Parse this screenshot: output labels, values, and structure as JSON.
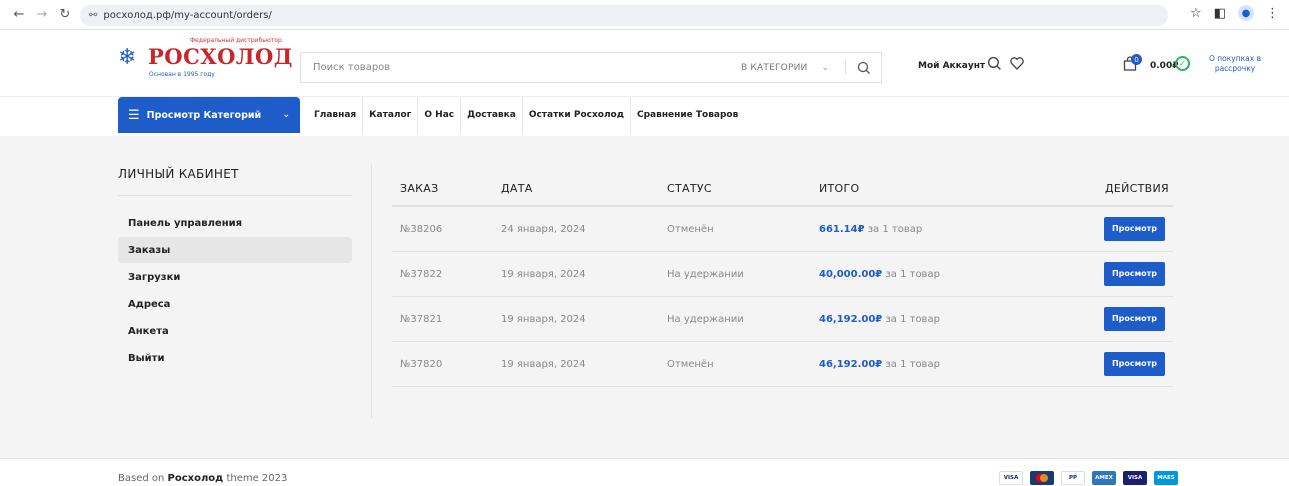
{
  "browser": {
    "url": "росхолод.рф/my-account/orders/"
  },
  "header": {
    "logo_tagline": "Федеральный дистрибьютор",
    "logo_brand": "РОСХОЛОД",
    "logo_since": "Основан в 1995 году",
    "search_placeholder": "Поиск товаров",
    "category_select": "В КАТЕГОРИИ",
    "account_label": "Мой Аккаунт",
    "cart_count": "0",
    "cart_total": "0.00₽",
    "installment_text": "О покупках в рассрочку"
  },
  "nav": {
    "categories_button": "Просмотр Категорий",
    "menu": [
      "Главная",
      "Каталог",
      "О Нас",
      "Доставка",
      "Остатки Росхолод",
      "Сравнение Товаров"
    ]
  },
  "sidebar": {
    "title": "ЛИЧНЫЙ КАБИНЕТ",
    "items": [
      "Панель управления",
      "Заказы",
      "Загрузки",
      "Адреса",
      "Анкета",
      "Выйти"
    ]
  },
  "orders": {
    "columns": [
      "ЗАКАЗ",
      "ДАТА",
      "СТАТУС",
      "ИТОГО",
      "ДЕЙСТВИЯ"
    ],
    "rows": [
      {
        "id": "№38206",
        "date": "24 января, 2024",
        "status": "Отменён",
        "total": "661.14₽",
        "qty": "за 1 товар",
        "action": "Просмотр"
      },
      {
        "id": "№37822",
        "date": "19 января, 2024",
        "status": "На удержании",
        "total": "40,000.00₽",
        "qty": "за 1 товар",
        "action": "Просмотр"
      },
      {
        "id": "№37821",
        "date": "19 января, 2024",
        "status": "На удержании",
        "total": "46,192.00₽",
        "qty": "за 1 товар",
        "action": "Просмотр"
      },
      {
        "id": "№37820",
        "date": "19 января, 2024",
        "status": "Отменён",
        "total": "46,192.00₽",
        "qty": "за 1 товар",
        "action": "Просмотр"
      }
    ]
  },
  "footer": {
    "credits_prefix": "Based on",
    "credits_brand": "Росхолод",
    "credits_suffix": "theme 2023",
    "payments": [
      "VISA",
      "MC",
      "PP",
      "AMEX",
      "VISA",
      "MAES"
    ]
  },
  "colors": {
    "accent": "#1e5cc9",
    "brand_red": "#c8252c",
    "green": "#2bb55a"
  }
}
